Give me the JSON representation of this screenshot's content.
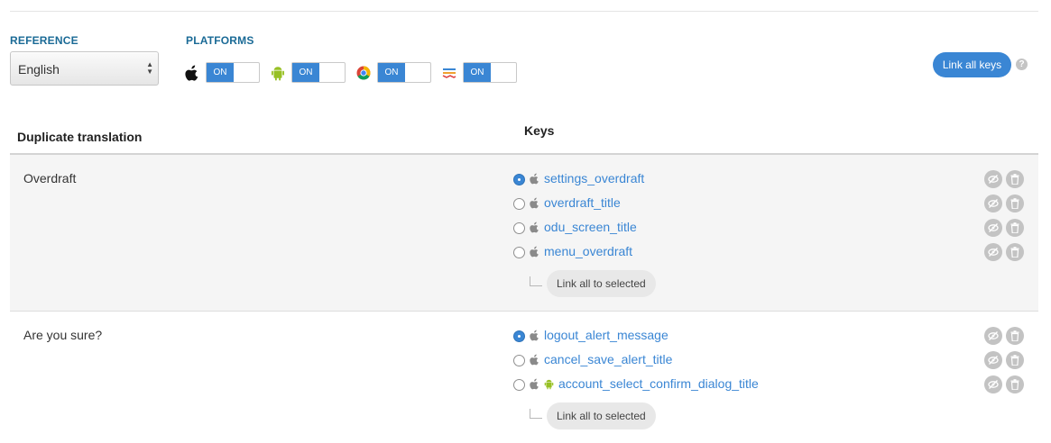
{
  "reference": {
    "label": "REFERENCE",
    "selected": "English"
  },
  "platforms": {
    "label": "PLATFORMS",
    "items": [
      {
        "icon": "apple-icon",
        "toggle": "ON"
      },
      {
        "icon": "android-icon",
        "toggle": "ON"
      },
      {
        "icon": "chrome-icon",
        "toggle": "ON"
      },
      {
        "icon": "web-icon",
        "toggle": "ON"
      }
    ]
  },
  "link_all_keys": "Link all keys",
  "help": "?",
  "table": {
    "col_translation": "Duplicate translation",
    "col_keys": "Keys"
  },
  "groups": [
    {
      "translation": "Overdraft",
      "keys": [
        {
          "name": "settings_overdraft",
          "platforms": [
            "apple"
          ],
          "selected": true
        },
        {
          "name": "overdraft_title",
          "platforms": [
            "apple"
          ],
          "selected": false
        },
        {
          "name": "odu_screen_title",
          "platforms": [
            "apple"
          ],
          "selected": false
        },
        {
          "name": "menu_overdraft",
          "platforms": [
            "apple"
          ],
          "selected": false
        }
      ],
      "link_selected": "Link all to selected"
    },
    {
      "translation": "Are you sure?",
      "keys": [
        {
          "name": "logout_alert_message",
          "platforms": [
            "apple"
          ],
          "selected": true
        },
        {
          "name": "cancel_save_alert_title",
          "platforms": [
            "apple"
          ],
          "selected": false
        },
        {
          "name": "account_select_confirm_dialog_title",
          "platforms": [
            "apple",
            "android"
          ],
          "selected": false
        }
      ],
      "link_selected": "Link all to selected"
    }
  ],
  "colors": {
    "accent": "#3a86d4",
    "heading": "#1a6a96",
    "android": "#97c024"
  }
}
